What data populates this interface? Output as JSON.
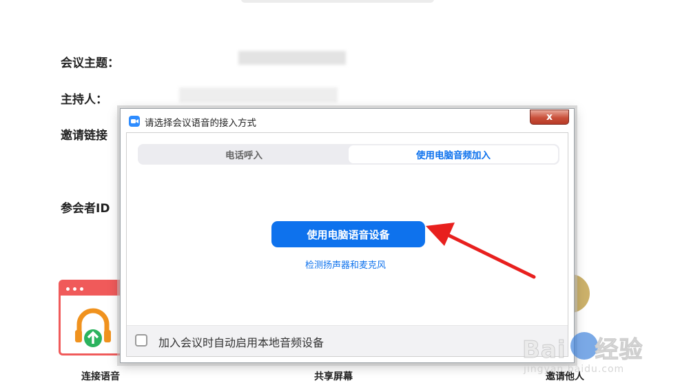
{
  "background": {
    "fields": {
      "topic_label": "会议主题：",
      "host_label": "主持人：",
      "invite_label": "邀请链接",
      "participant_id_label": "参会者ID"
    },
    "actions": {
      "join_audio": "连接语音",
      "share_screen": "共享屏幕",
      "invite_others": "邀请他人"
    }
  },
  "dialog": {
    "title": "请选择会议语音的接入方式",
    "close_symbol": "x",
    "tabs": [
      {
        "label": "电话呼入",
        "active": false
      },
      {
        "label": "使用电脑音频加入",
        "active": true
      }
    ],
    "primary_button": "使用电脑语音设备",
    "test_link": "检测扬声器和麦克风",
    "checkbox": {
      "label": "加入会议时自动启用本地音频设备",
      "checked": false
    }
  },
  "watermark": {
    "main": "Bai",
    "brand": "经验",
    "sub": "jingyan.baidu.com"
  },
  "colors": {
    "accent": "#0e72ed",
    "annotation_arrow": "#e8201e"
  }
}
